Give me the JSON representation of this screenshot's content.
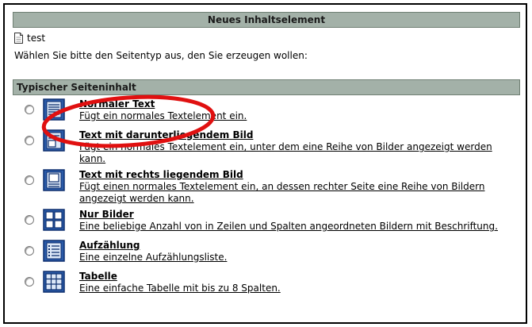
{
  "header": {
    "title": "Neues Inhaltselement"
  },
  "page": {
    "name": "test",
    "icon": "page-icon"
  },
  "instruction": "Wählen Sie bitte den Seitentyp aus, den Sie erzeugen wollen:",
  "section": {
    "title": "Typischer Seiteninhalt"
  },
  "options": [
    {
      "title": "Normaler Text",
      "description": "Fügt ein normales Textelement ein.",
      "icon": "text-icon"
    },
    {
      "title": "Text mit darunterliegendem Bild",
      "description": "Fügt ein normales Textelement ein, unter dem eine Reihe von Bilder angezeigt werden kann.",
      "icon": "text-image-below-icon"
    },
    {
      "title": "Text mit rechts liegendem Bild",
      "description": "Fügt einen normales Textelement ein, an dessen rechter Seite eine Reihe von Bildern angezeigt werden kann.",
      "icon": "text-image-right-icon"
    },
    {
      "title": "Nur Bilder",
      "description": "Eine beliebige Anzahl von in Zeilen und Spalten angeordneten Bildern mit Beschriftung.",
      "icon": "images-grid-icon"
    },
    {
      "title": "Aufzählung",
      "description": "Eine einzelne Aufzählungsliste.",
      "icon": "bullet-list-icon"
    },
    {
      "title": "Tabelle",
      "description": "Eine einfache Tabelle mit bis zu 8 Spalten.",
      "icon": "table-icon"
    }
  ],
  "colors": {
    "header_bg": "#a3b1a8",
    "icon_blue": "#2a5aa8",
    "annotation_red": "#e01010"
  }
}
